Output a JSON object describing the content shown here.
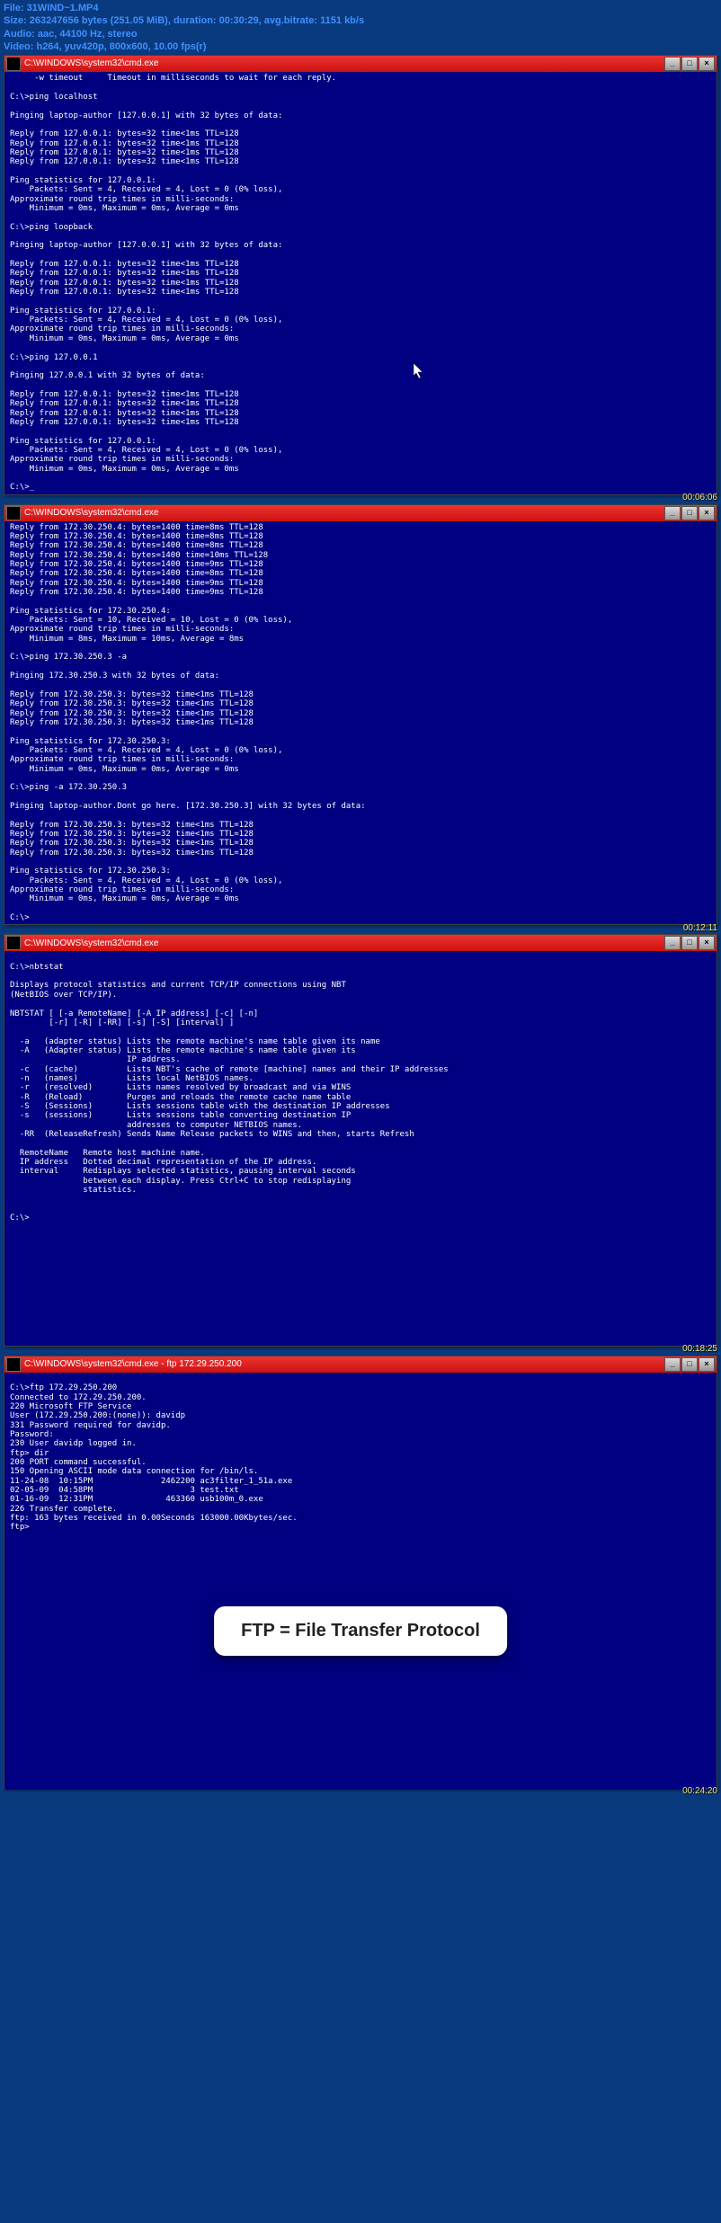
{
  "file_info": {
    "file": "File: 31WIND~1.MP4",
    "size": "Size: 263247656 bytes (251.05 MiB), duration: 00:30:29, avg.bitrate: 1151 kb/s",
    "audio": "Audio: aac, 44100 Hz, stereo",
    "video": "Video: h264, yuv420p, 800x600, 10.00 fps(r)"
  },
  "window_title": "C:\\WINDOWS\\system32\\cmd.exe",
  "window_title_ftp": "C:\\WINDOWS\\system32\\cmd.exe - ftp 172.29.250.200",
  "win_btns": {
    "min": "_",
    "max": "□",
    "close": "×"
  },
  "timecodes": {
    "t1": "00:06:06",
    "t2": "00:12:11",
    "t3": "00:18:25",
    "t4": "00:24:20"
  },
  "term1": [
    "     -w timeout     Timeout in milliseconds to wait for each reply.",
    "",
    "C:\\>ping localhost",
    "",
    "Pinging laptop-author [127.0.0.1] with 32 bytes of data:",
    "",
    "Reply from 127.0.0.1: bytes=32 time<1ms TTL=128",
    "Reply from 127.0.0.1: bytes=32 time<1ms TTL=128",
    "Reply from 127.0.0.1: bytes=32 time<1ms TTL=128",
    "Reply from 127.0.0.1: bytes=32 time<1ms TTL=128",
    "",
    "Ping statistics for 127.0.0.1:",
    "    Packets: Sent = 4, Received = 4, Lost = 0 (0% loss),",
    "Approximate round trip times in milli-seconds:",
    "    Minimum = 0ms, Maximum = 0ms, Average = 0ms",
    "",
    "C:\\>ping loopback",
    "",
    "Pinging laptop-author [127.0.0.1] with 32 bytes of data:",
    "",
    "Reply from 127.0.0.1: bytes=32 time<1ms TTL=128",
    "Reply from 127.0.0.1: bytes=32 time<1ms TTL=128",
    "Reply from 127.0.0.1: bytes=32 time<1ms TTL=128",
    "Reply from 127.0.0.1: bytes=32 time<1ms TTL=128",
    "",
    "Ping statistics for 127.0.0.1:",
    "    Packets: Sent = 4, Received = 4, Lost = 0 (0% loss),",
    "Approximate round trip times in milli-seconds:",
    "    Minimum = 0ms, Maximum = 0ms, Average = 0ms",
    "",
    "C:\\>ping 127.0.0.1",
    "",
    "Pinging 127.0.0.1 with 32 bytes of data:",
    "",
    "Reply from 127.0.0.1: bytes=32 time<1ms TTL=128",
    "Reply from 127.0.0.1: bytes=32 time<1ms TTL=128",
    "Reply from 127.0.0.1: bytes=32 time<1ms TTL=128",
    "Reply from 127.0.0.1: bytes=32 time<1ms TTL=128",
    "",
    "Ping statistics for 127.0.0.1:",
    "    Packets: Sent = 4, Received = 4, Lost = 0 (0% loss),",
    "Approximate round trip times in milli-seconds:",
    "    Minimum = 0ms, Maximum = 0ms, Average = 0ms",
    "",
    "C:\\>_"
  ],
  "term2": [
    "Reply from 172.30.250.4: bytes=1400 time=8ms TTL=128",
    "Reply from 172.30.250.4: bytes=1400 time=8ms TTL=128",
    "Reply from 172.30.250.4: bytes=1400 time=8ms TTL=128",
    "Reply from 172.30.250.4: bytes=1400 time=10ms TTL=128",
    "Reply from 172.30.250.4: bytes=1400 time=9ms TTL=128",
    "Reply from 172.30.250.4: bytes=1400 time=8ms TTL=128",
    "Reply from 172.30.250.4: bytes=1400 time=9ms TTL=128",
    "Reply from 172.30.250.4: bytes=1400 time=9ms TTL=128",
    "",
    "Ping statistics for 172.30.250.4:",
    "    Packets: Sent = 10, Received = 10, Lost = 0 (0% loss),",
    "Approximate round trip times in milli-seconds:",
    "    Minimum = 8ms, Maximum = 10ms, Average = 8ms",
    "",
    "C:\\>ping 172.30.250.3 -a",
    "",
    "Pinging 172.30.250.3 with 32 bytes of data:",
    "",
    "Reply from 172.30.250.3: bytes=32 time<1ms TTL=128",
    "Reply from 172.30.250.3: bytes=32 time<1ms TTL=128",
    "Reply from 172.30.250.3: bytes=32 time<1ms TTL=128",
    "Reply from 172.30.250.3: bytes=32 time<1ms TTL=128",
    "",
    "Ping statistics for 172.30.250.3:",
    "    Packets: Sent = 4, Received = 4, Lost = 0 (0% loss),",
    "Approximate round trip times in milli-seconds:",
    "    Minimum = 0ms, Maximum = 0ms, Average = 0ms",
    "",
    "C:\\>ping -a 172.30.250.3",
    "",
    "Pinging laptop-author.Dont go here. [172.30.250.3] with 32 bytes of data:",
    "",
    "Reply from 172.30.250.3: bytes=32 time<1ms TTL=128",
    "Reply from 172.30.250.3: bytes=32 time<1ms TTL=128",
    "Reply from 172.30.250.3: bytes=32 time<1ms TTL=128",
    "Reply from 172.30.250.3: bytes=32 time<1ms TTL=128",
    "",
    "Ping statistics for 172.30.250.3:",
    "    Packets: Sent = 4, Received = 4, Lost = 0 (0% loss),",
    "Approximate round trip times in milli-seconds:",
    "    Minimum = 0ms, Maximum = 0ms, Average = 0ms",
    "",
    "C:\\>"
  ],
  "term3": [
    "",
    "C:\\>nbtstat",
    "",
    "Displays protocol statistics and current TCP/IP connections using NBT",
    "(NetBIOS over TCP/IP).",
    "",
    "NBTSTAT [ [-a RemoteName] [-A IP address] [-c] [-n]",
    "        [-r] [-R] [-RR] [-s] [-S] [interval] ]",
    "",
    "  -a   (adapter status) Lists the remote machine's name table given its name",
    "  -A   (Adapter status) Lists the remote machine's name table given its",
    "                        IP address.",
    "  -c   (cache)          Lists NBT's cache of remote [machine] names and their IP addresses",
    "  -n   (names)          Lists local NetBIOS names.",
    "  -r   (resolved)       Lists names resolved by broadcast and via WINS",
    "  -R   (Reload)         Purges and reloads the remote cache name table",
    "  -S   (Sessions)       Lists sessions table with the destination IP addresses",
    "  -s   (sessions)       Lists sessions table converting destination IP",
    "                        addresses to computer NETBIOS names.",
    "  -RR  (ReleaseRefresh) Sends Name Release packets to WINS and then, starts Refresh",
    "",
    "  RemoteName   Remote host machine name.",
    "  IP address   Dotted decimal representation of the IP address.",
    "  interval     Redisplays selected statistics, pausing interval seconds",
    "               between each display. Press Ctrl+C to stop redisplaying",
    "               statistics.",
    "",
    "",
    "C:\\>",
    "",
    "",
    "",
    "",
    "",
    "",
    "",
    "",
    "",
    "",
    "",
    "",
    "",
    ""
  ],
  "term4": [
    "",
    "C:\\>ftp 172.29.250.200",
    "Connected to 172.29.250.200.",
    "220 Microsoft FTP Service",
    "User (172.29.250.200:(none)): davidp",
    "331 Password required for davidp.",
    "Password:",
    "230 User davidp logged in.",
    "ftp> dir",
    "200 PORT command successful.",
    "150 Opening ASCII mode data connection for /bin/ls.",
    "11-24-08  10:15PM              2462200 ac3filter_1_51a.exe",
    "02-05-09  04:58PM                    3 test.txt",
    "01-16-09  12:31PM               463360 usb100m_0.exe",
    "226 Transfer complete.",
    "ftp: 163 bytes received in 0.00Seconds 163000.00Kbytes/sec.",
    "ftp>"
  ],
  "ftp_label": "FTP = File Transfer Protocol"
}
